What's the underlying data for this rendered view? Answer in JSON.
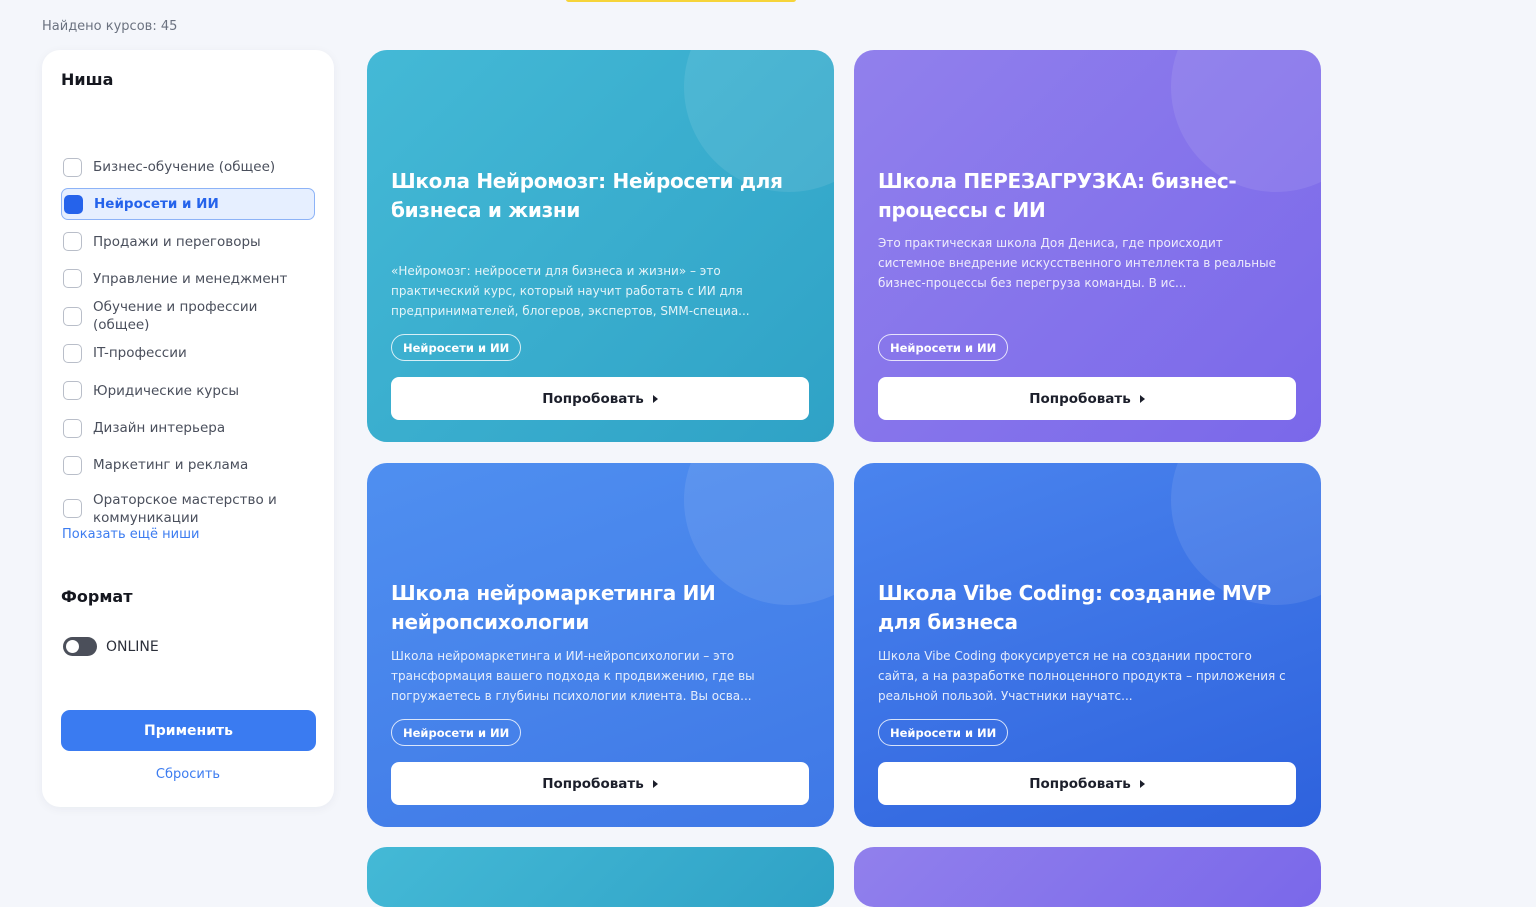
{
  "results": {
    "found_text": "Найдено курсов: 45"
  },
  "filters": {
    "niche_title": "Ниша",
    "niches": [
      {
        "label": "Бизнес-обучение (общее)",
        "selected": false
      },
      {
        "label": "Нейросети и ИИ",
        "selected": true
      },
      {
        "label": "Продажи и переговоры",
        "selected": false
      },
      {
        "label": "Управление и менеджмент",
        "selected": false
      },
      {
        "label": "Обучение и профессии (общее)",
        "selected": false
      },
      {
        "label": "IT-профессии",
        "selected": false
      },
      {
        "label": "Юридические курсы",
        "selected": false
      },
      {
        "label": "Дизайн интерьера",
        "selected": false
      },
      {
        "label": "Маркетинг и реклама",
        "selected": false
      },
      {
        "label": "Ораторское мастерство и коммуникации",
        "selected": false
      }
    ],
    "show_more": "Показать ещё ниши",
    "format_title": "Формат",
    "online_label": "ONLINE",
    "online_enabled": false,
    "apply_label": "Применить",
    "reset_label": "Сбросить"
  },
  "courses": [
    {
      "title": "Школа Нейромозг: Нейросети для бизнеса и жизни",
      "description": "«Нейромозг: нейросети для бизнеса и жизни» – это практический курс, который научит работать с ИИ для предпринимателей, блогеров, экспертов, SMM-специа...",
      "tag": "Нейросети и ИИ",
      "button": "Попробовать",
      "color": "#3db0d0"
    },
    {
      "title": "Школа ПЕРЕЗАГРУЗКА: бизнес-процессы с ИИ",
      "description": "Это практическая школа Доя Дениса, где происходит системное внедрение искусственного интеллекта в реальные бизнес-процессы без перегруза команды. В ис...",
      "tag": "Нейросети и ИИ",
      "button": "Попробовать",
      "color": "#8574eb"
    },
    {
      "title": "Школа нейромаркетинга ИИ нейропсихологии",
      "description": "Школа нейромаркетинга и ИИ-нейропсихологии – это трансформация вашего подхода к продвижению, где вы погружаетесь в глубины психологии клиента. Вы осва...",
      "tag": "Нейросети и ИИ",
      "button": "Попробовать",
      "color": "#4a88ee"
    },
    {
      "title": "Школа Vibe Coding: создание MVP для бизнеса",
      "description": "Школа Vibe Coding фокусируется не на создании простого сайта, а на разработке полноценного продукта – приложения с реальной пользой. Участники научатс...",
      "tag": "Нейросети и ИИ",
      "button": "Попробовать",
      "color": "#3b70e4"
    }
  ]
}
